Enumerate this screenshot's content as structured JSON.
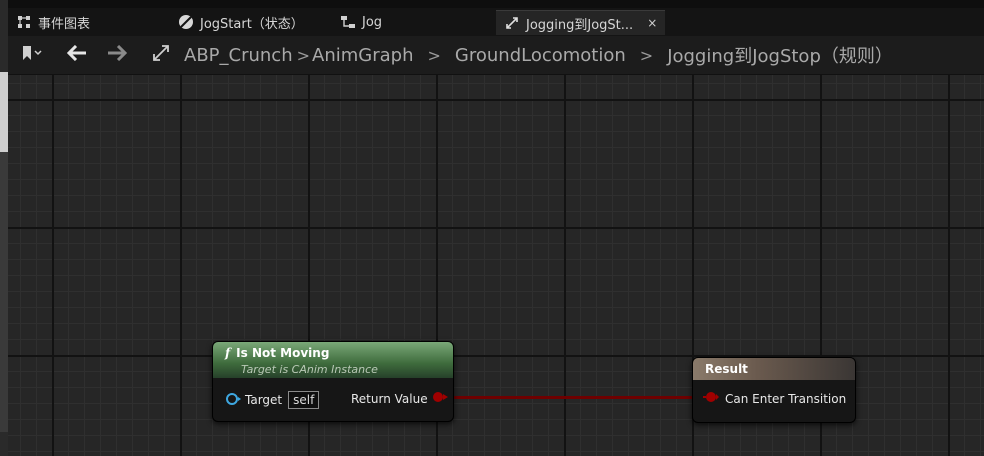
{
  "tabs": [
    {
      "label": "事件图表",
      "icon": "event-graph-icon"
    },
    {
      "label": "JogStart（状态）",
      "icon": "state-icon"
    },
    {
      "label": "Jog",
      "icon": "state-machine-icon"
    },
    {
      "label": "Jogging到JogSt...",
      "icon": "transition-icon",
      "close": "×",
      "active": true
    }
  ],
  "breadcrumb": {
    "items": [
      "ABP_Crunch",
      "AnimGraph",
      "GroundLocomotion",
      "Jogging到JogStop（规则）"
    ],
    "sep": ">"
  },
  "nodes": {
    "function": {
      "icon_glyph": "f",
      "title": "Is Not Moving",
      "subtitle": "Target is CAnim Instance",
      "target_label": "Target",
      "target_value": "self",
      "return_label": "Return Value"
    },
    "result": {
      "title": "Result",
      "input_label": "Can Enter Transition"
    }
  },
  "colors": {
    "bool_pin": "#a00000",
    "object_pin": "#3ea7e0",
    "wire": "#6e0000"
  }
}
